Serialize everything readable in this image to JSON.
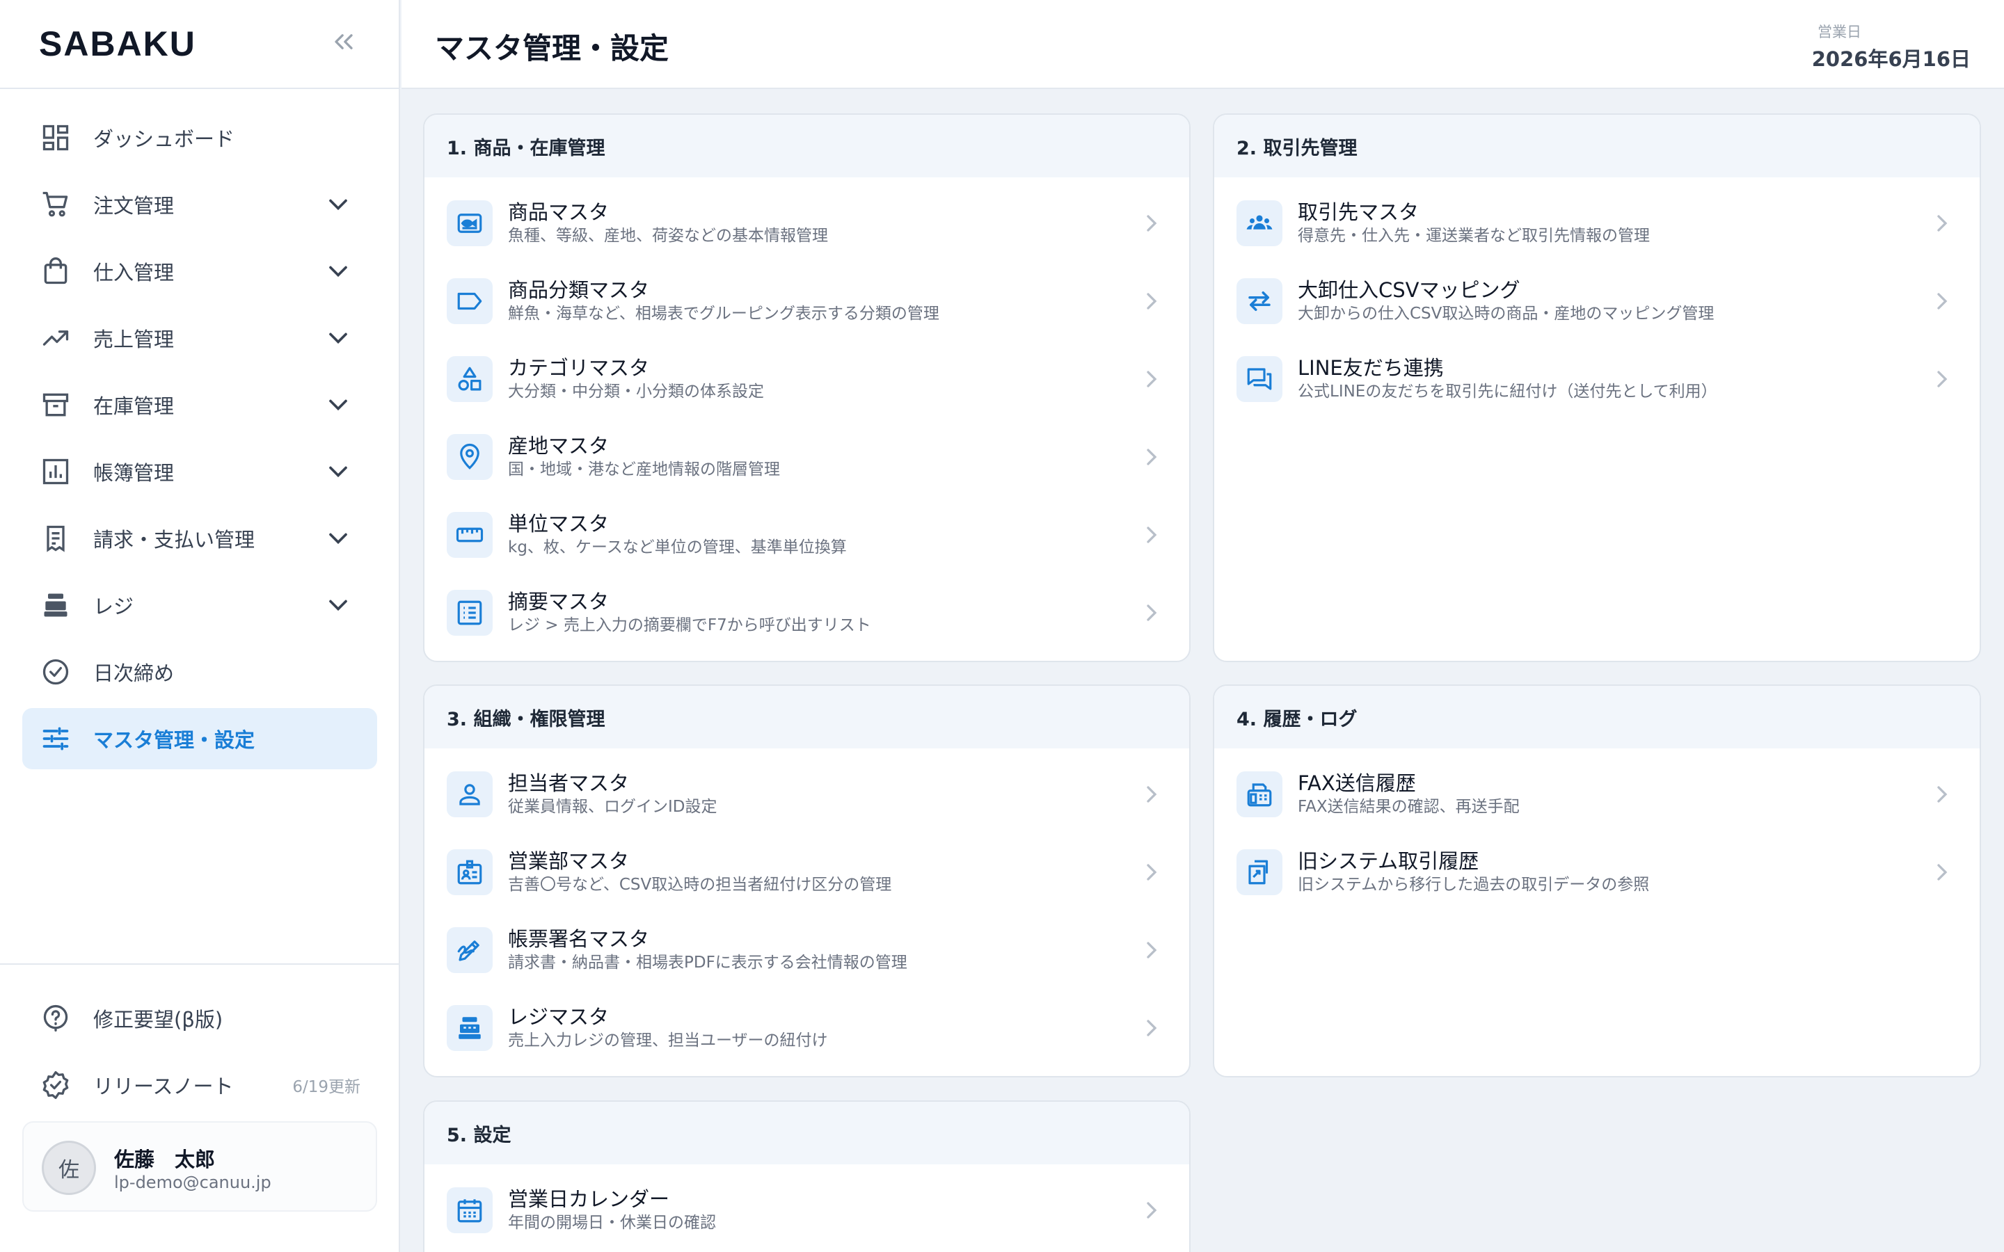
{
  "app": {
    "logo": "SABAKU"
  },
  "sidebar": {
    "items": [
      {
        "label": "ダッシュボード",
        "icon": "dashboard-icon"
      },
      {
        "label": "注文管理",
        "icon": "cart-icon"
      },
      {
        "label": "仕入管理",
        "icon": "shopping-bag-icon"
      },
      {
        "label": "売上管理",
        "icon": "trending-up-icon"
      },
      {
        "label": "在庫管理",
        "icon": "archive-icon"
      },
      {
        "label": "帳簿管理",
        "icon": "bar-chart-icon"
      },
      {
        "label": "請求・支払い管理",
        "icon": "receipt-icon"
      },
      {
        "label": "レジ",
        "icon": "cash-register-icon"
      },
      {
        "label": "日次締め",
        "icon": "check-circle-icon"
      },
      {
        "label": "マスタ管理・設定",
        "icon": "sliders-icon",
        "active": true
      }
    ],
    "bottom": {
      "feedback_label": "修正要望(β版)",
      "release_label": "リリースノート",
      "release_meta": "6/19更新"
    },
    "user": {
      "avatar": "佐",
      "name": "佐藤　太郎",
      "email": "lp-demo@canuu.jp"
    }
  },
  "header": {
    "title": "マスタ管理・設定",
    "date_label": "営業日",
    "date_value": "2026年6月16日"
  },
  "sections": [
    {
      "title": "1. 商品・在庫管理",
      "items": [
        {
          "title": "商品マスタ",
          "desc": "魚種、等級、産地、荷姿などの基本情報管理",
          "icon": "fish-icon"
        },
        {
          "title": "商品分類マスタ",
          "desc": "鮮魚・海草など、相場表でグルーピング表示する分類の管理",
          "icon": "label-icon"
        },
        {
          "title": "カテゴリマスタ",
          "desc": "大分類・中分類・小分類の体系設定",
          "icon": "shapes-icon"
        },
        {
          "title": "産地マスタ",
          "desc": "国・地域・港など産地情報の階層管理",
          "icon": "location-pin-icon"
        },
        {
          "title": "単位マスタ",
          "desc": "kg、枚、ケースなど単位の管理、基準単位換算",
          "icon": "ruler-icon"
        },
        {
          "title": "摘要マスタ",
          "desc": "レジ > 売上入力の摘要欄でF7から呼び出すリスト",
          "icon": "list-icon"
        }
      ]
    },
    {
      "title": "2. 取引先管理",
      "items": [
        {
          "title": "取引先マスタ",
          "desc": "得意先・仕入先・運送業者など取引先情報の管理",
          "icon": "group-icon"
        },
        {
          "title": "大卸仕入CSVマッピング",
          "desc": "大卸からの仕入CSV取込時の商品・産地のマッピング管理",
          "icon": "swap-icon"
        },
        {
          "title": "LINE友だち連携",
          "desc": "公式LINEの友だちを取引先に紐付け（送付先として利用）",
          "icon": "chat-icon"
        }
      ]
    },
    {
      "title": "3. 組織・権限管理",
      "items": [
        {
          "title": "担当者マスタ",
          "desc": "従業員情報、ログインID設定",
          "icon": "person-icon"
        },
        {
          "title": "営業部マスタ",
          "desc": "吉善〇号など、CSV取込時の担当者紐付け区分の管理",
          "icon": "badge-icon"
        },
        {
          "title": "帳票署名マスタ",
          "desc": "請求書・納品書・相場表PDFに表示する会社情報の管理",
          "icon": "signature-icon"
        },
        {
          "title": "レジマスタ",
          "desc": "売上入力レジの管理、担当ユーザーの紐付け",
          "icon": "register-icon"
        }
      ]
    },
    {
      "title": "4. 履歴・ログ",
      "items": [
        {
          "title": "FAX送信履歴",
          "desc": "FAX送信結果の確認、再送手配",
          "icon": "fax-icon"
        },
        {
          "title": "旧システム取引履歴",
          "desc": "旧システムから移行した過去の取引データの参照",
          "icon": "migration-icon"
        }
      ]
    },
    {
      "title": "5. 設定",
      "items": [
        {
          "title": "営業日カレンダー",
          "desc": "年間の開場日・休業日の確認",
          "icon": "calendar-icon"
        }
      ]
    }
  ]
}
